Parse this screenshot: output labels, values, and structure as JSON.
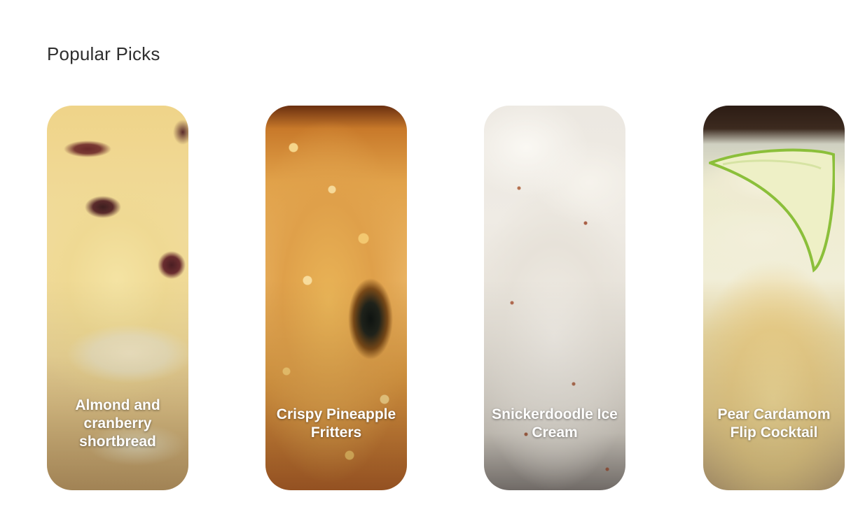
{
  "section": {
    "title": "Popular Picks"
  },
  "cards": [
    {
      "label": "Almond and cranberry shortbread"
    },
    {
      "label": "Crispy Pineapple Fritters"
    },
    {
      "label": "Snickerdoodle Ice Cream"
    },
    {
      "label": "Pear Cardamom Flip Cocktail"
    }
  ]
}
